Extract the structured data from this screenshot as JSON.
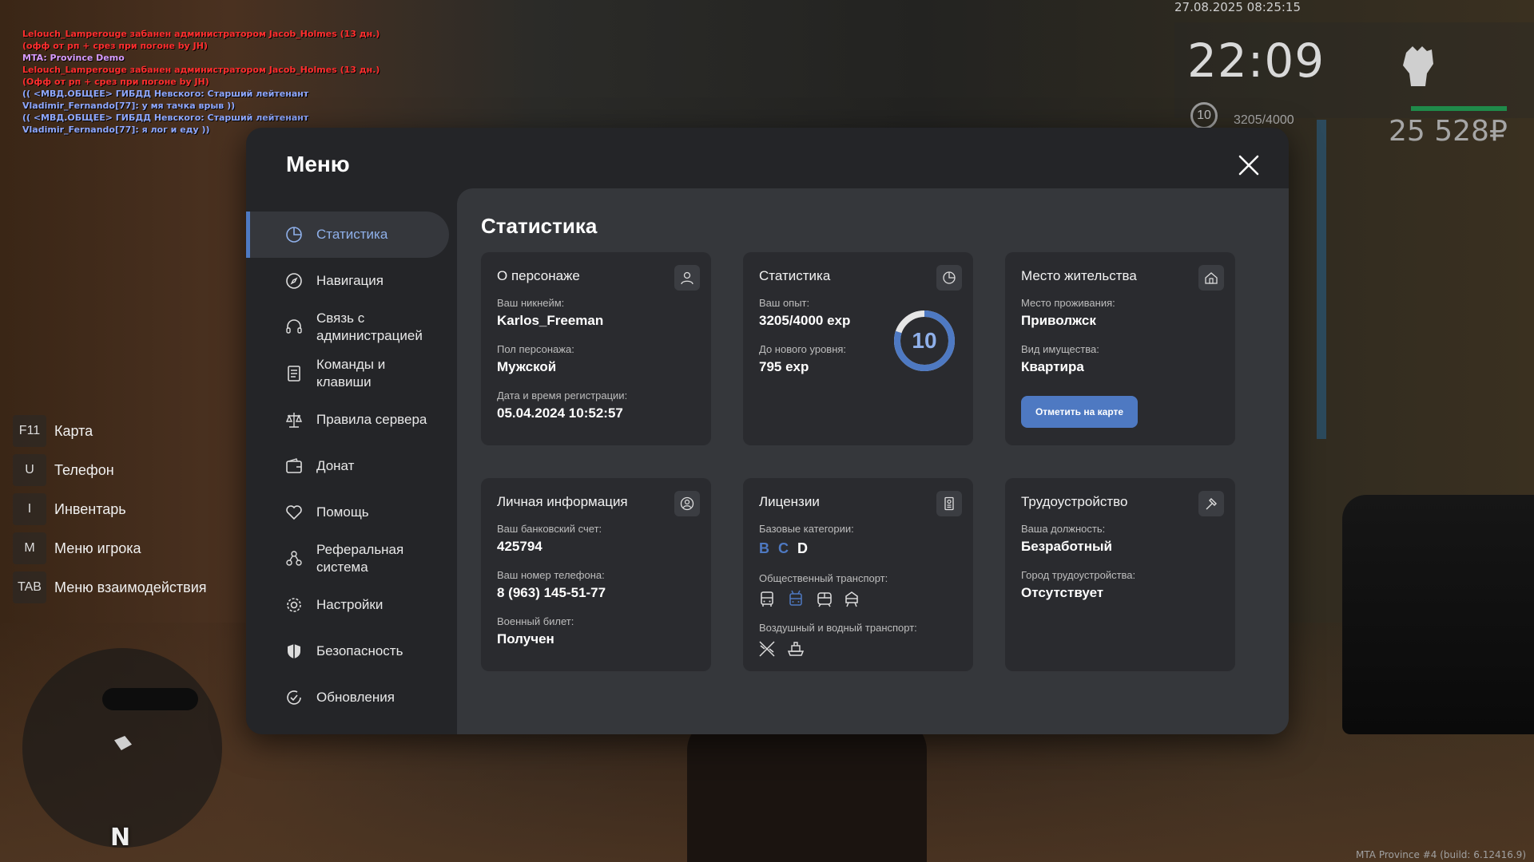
{
  "chat": [
    {
      "color": "#ff2e2e",
      "text": "Lelouch_Lamperouge забанен администратором Jacob_Holmes (13 дн.) (офф от рп + срез при погоне by JH)"
    },
    {
      "color": "#d79bff",
      "text": "MTA: Province Demo"
    },
    {
      "color": "#ff2e2e",
      "text": "Lelouch_Lamperouge забанен администратором Jacob_Holmes (13 дн.) (Офф от рп + срез при погоне by JH)"
    },
    {
      "color": "#8fa8ff",
      "text": "(( <МВД.ОБЩЕЕ> ГИБДД Невского: Старший лейтенант Vladimir_Fernando[77]: у мя тачка врыв ))"
    },
    {
      "color": "#8fa8ff",
      "text": "(( <МВД.ОБЩЕЕ> ГИБДД Невского: Старший лейтенант Vladimir_Fernando[77]: я лог и еду ))"
    }
  ],
  "hud": {
    "date": "27.08.2025 08:25:15",
    "time": "22:09",
    "level": "10",
    "exp": "3205/4000",
    "money": "25 528₽"
  },
  "hotkeys": [
    {
      "key": "F11",
      "label": "Карта"
    },
    {
      "key": "U",
      "label": "Телефон"
    },
    {
      "key": "I",
      "label": "Инвентарь"
    },
    {
      "key": "M",
      "label": "Меню игрока"
    },
    {
      "key": "TAB",
      "label": "Меню взаимодействия"
    }
  ],
  "radar": {
    "north": "N"
  },
  "build": "MTA Province #4 (build: 6.12416.9)",
  "menu": {
    "title": "Меню",
    "items": [
      {
        "label": "Статистика",
        "icon": "chart-pie-icon"
      },
      {
        "label": "Навигация",
        "icon": "compass-icon"
      },
      {
        "label": "Связь с администрацией",
        "icon": "headset-icon"
      },
      {
        "label": "Команды и клавиши",
        "icon": "document-list-icon"
      },
      {
        "label": "Правила сервера",
        "icon": "scales-icon"
      },
      {
        "label": "Донат",
        "icon": "wallet-icon"
      },
      {
        "label": "Помощь",
        "icon": "heart-hands-icon"
      },
      {
        "label": "Реферальная система",
        "icon": "referral-icon"
      },
      {
        "label": "Настройки",
        "icon": "gear-icon"
      },
      {
        "label": "Безопасность",
        "icon": "shield-icon"
      },
      {
        "label": "Обновления",
        "icon": "refresh-check-icon"
      }
    ]
  },
  "stats": {
    "title": "Статистика",
    "character": {
      "title": "О персонаже",
      "nickname_label": "Ваш никнейм:",
      "nickname": "Karlos_Freeman",
      "gender_label": "Пол персонажа:",
      "gender": "Мужской",
      "reg_label": "Дата и время регистрации:",
      "reg": "05.04.2024 10:52:57"
    },
    "statistics": {
      "title": "Статистика",
      "exp_label": "Ваш опыт:",
      "exp": "3205/4000 exp",
      "next_label": "До нового уровня:",
      "next": "795 exp",
      "level": "10",
      "progress": 0.80125
    },
    "residence": {
      "title": "Место жительства",
      "place_label": "Место проживания:",
      "place": "Приволжск",
      "property_label": "Вид имущества:",
      "property": "Квартира",
      "map_button": "Отметить на карте"
    },
    "personal": {
      "title": "Личная информация",
      "bank_label": "Ваш банковский счет:",
      "bank": "425794",
      "phone_label": "Ваш номер телефона:",
      "phone": "8 (963) 145-51-77",
      "military_label": "Военный билет:",
      "military": "Получен"
    },
    "licenses": {
      "title": "Лицензии",
      "base_label": "Базовые категории:",
      "categories": [
        {
          "name": "B",
          "color": "#4e79c2"
        },
        {
          "name": "C",
          "color": "#4e79c2"
        },
        {
          "name": "D",
          "color": "#ffffff"
        }
      ],
      "public_label": "Общественный транспорт:",
      "air_label": "Воздушный и водный транспорт:"
    },
    "employment": {
      "title": "Трудоустройство",
      "position_label": "Ваша должность:",
      "position": "Безработный",
      "city_label": "Город трудоустройства:",
      "city": "Отсутствует"
    }
  },
  "colors": {
    "accent": "#4e79c2",
    "panel": "#242528",
    "content": "#35373b",
    "card": "#2a2b2f"
  }
}
